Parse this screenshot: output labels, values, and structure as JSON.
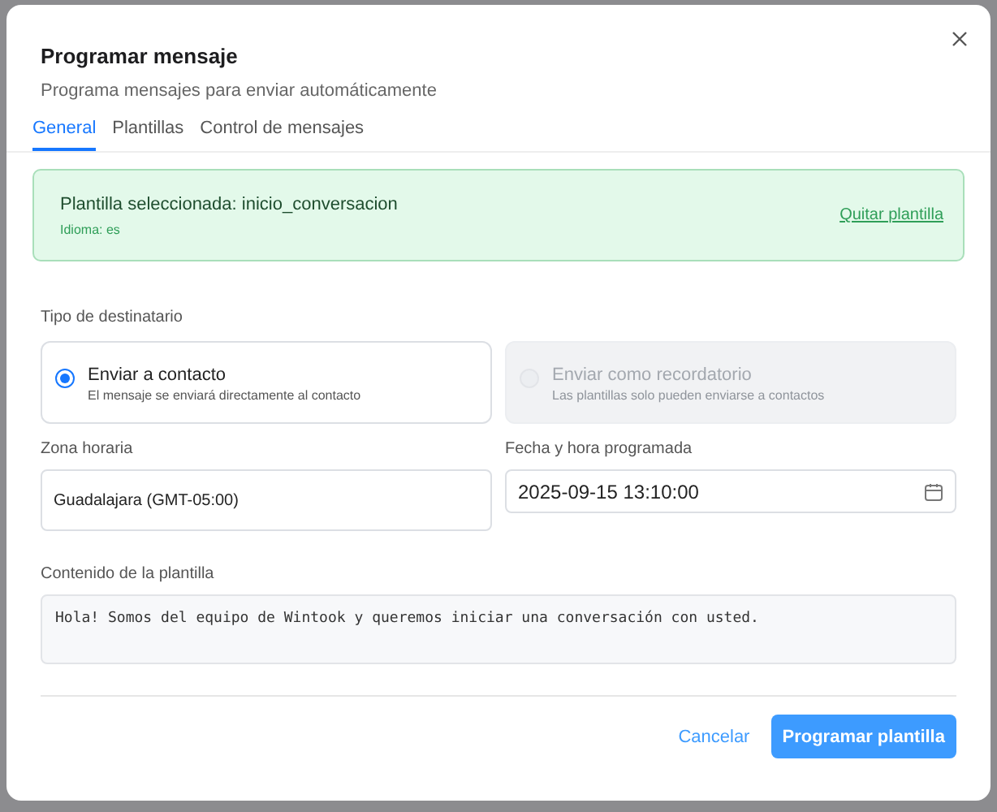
{
  "dialog": {
    "title": "Programar mensaje",
    "subtitle": "Programa mensajes para enviar automáticamente",
    "tabs": [
      {
        "label": "General",
        "selected": true
      },
      {
        "label": "Plantillas",
        "selected": false
      },
      {
        "label": "Control de mensajes",
        "selected": false
      }
    ],
    "template_banner": {
      "title": "Plantilla seleccionada: inicio_conversacion",
      "language": "Idioma: es",
      "action": "Quitar plantilla"
    },
    "recipient": {
      "label": "Tipo de destinatario",
      "options": [
        {
          "title": "Enviar a contacto",
          "description": "El mensaje se enviará directamente al contacto",
          "selected": true,
          "disabled": false
        },
        {
          "title": "Enviar como recordatorio",
          "description": "Las plantillas solo pueden enviarse a contactos",
          "selected": false,
          "disabled": true
        }
      ]
    },
    "timezone": {
      "label": "Zona horaria",
      "value": "Guadalajara (GMT-05:00)"
    },
    "datetime": {
      "label": "Fecha y hora programada",
      "value": "2025-09-15 13:10:00"
    },
    "content": {
      "label": "Contenido de la plantilla",
      "value": "Hola! Somos del equipo de Wintook y queremos iniciar una conversación con usted."
    },
    "buttons": [
      {
        "kind": "link",
        "label": "Cancelar"
      },
      {
        "kind": "primary",
        "label": "Programar plantilla"
      }
    ]
  }
}
